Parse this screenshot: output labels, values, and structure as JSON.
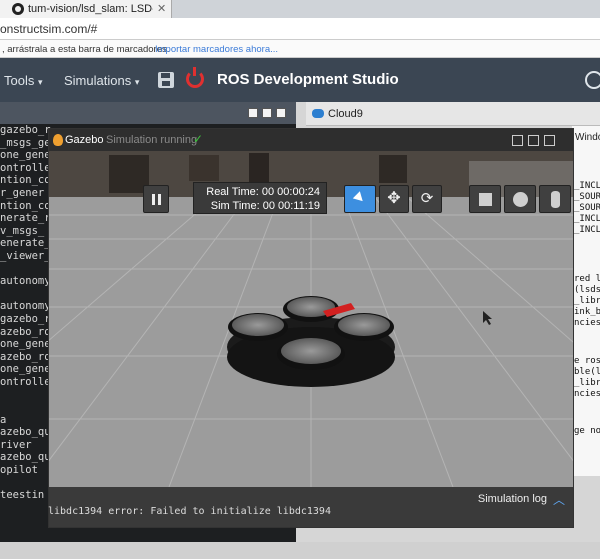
{
  "browser": {
    "tab_title": "tum-vision/lsd_slam: LSD-SLAM",
    "tab_close": "✕",
    "url": "onstructsim.com/#",
    "bookmark_hint": ", arrástrala a esta barra de marcadores.",
    "bookmark_link": "Importar marcadores ahora..."
  },
  "ros": {
    "menu_tools": "Tools",
    "menu_simulations": "Simulations",
    "brand": "ROS Development Studio",
    "caret": "▾"
  },
  "terminal": {
    "lines": [
      "gazebo_r",
      "_msgs_gen",
      "one_gene",
      "ontrolle",
      "ntion_co",
      "r_gener",
      "ntion_co",
      "nerate_r",
      "v_msgs_",
      "enerate_",
      "_viewer_",
      "",
      "autonomy",
      "",
      "autonomy",
      "gazebo_r",
      "azebo_ro",
      "one_gene",
      "azebo_ro",
      "one_gene",
      "ontrolle",
      "",
      "",
      "a",
      "azebo_qu",
      "river",
      "azebo_qu",
      "opilot",
      "",
      "teestin"
    ]
  },
  "cloud9": {
    "label": "Cloud9",
    "window_text": "Window",
    "snippet_a": "_INCLU\n_SOUR\n_SOUR\n_INCL\n_INCL",
    "snippet_b": "red l\n(lsds\n_libr\nink_b\nncies",
    "snippet_c": "e ros\nble(l\n_libr\nncies",
    "snippet_d": "ge no"
  },
  "gazebo": {
    "title": "Gazebo",
    "status": "Simulation running",
    "check": "✓",
    "real_time": "Real Time: 00 00:00:24",
    "sim_time": "Sim Time: 00 00:11:19",
    "move_glyph": "✥",
    "rotate_glyph": "⟳",
    "sim_log": "Simulation log",
    "chevron": "︿",
    "error": "libdc1394 error: Failed to initialize libdc1394"
  }
}
